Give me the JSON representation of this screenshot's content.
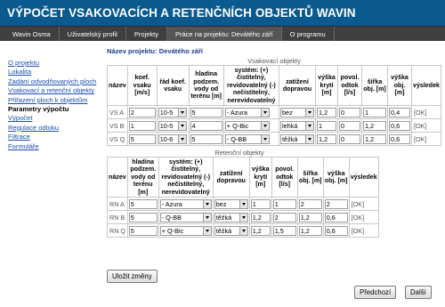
{
  "header": {
    "title": "VÝPOČET VSAKOVACÍCH A RETENČNÍCH OBJEKTŮ WAVIN"
  },
  "topnav": [
    {
      "label": "Wavin Osma"
    },
    {
      "label": "Uživatelský profil"
    },
    {
      "label": "Projekty"
    },
    {
      "label": "Práce na projektu: Devátého září"
    },
    {
      "label": "O programu"
    }
  ],
  "sidebar": [
    {
      "label": "O projektu"
    },
    {
      "label": "Lokalita"
    },
    {
      "label": "Zadání odvodňovaných ploch"
    },
    {
      "label": "Vsakovací a retenční objekty"
    },
    {
      "label": "Přiřazení ploch k objektům"
    },
    {
      "label": "Parametry výpočtu"
    },
    {
      "label": "Výpočet"
    },
    {
      "label": "Regulace odtoku"
    },
    {
      "label": "Filtrace"
    },
    {
      "label": "Formuláře"
    }
  ],
  "main": {
    "project_name": "Název projektu: Devátého září",
    "vsak": {
      "title": "Vsakovací objekty",
      "headers": [
        "název",
        "koef. vsaku [m/s]",
        "řád koef. vsaku",
        "hladina podzem. vody od terénu [m]",
        "systém: (+) čistitelný, revidovatelný (-) nečistitelný, nerevidovatelný",
        "zatížení dopravou",
        "výška krytí [m]",
        "povol. odtok [l/s]",
        "šířka obj. [m]",
        "výška obj. [m]",
        "výsledek"
      ],
      "rows": [
        {
          "name": "VS A",
          "koef": "2",
          "rad": "10-5",
          "hladina": "5",
          "system": "- Azura",
          "zatizeni": "bez",
          "kryti": "1,2",
          "odtok": "0",
          "sirka": "1",
          "vyska": "0,4",
          "vysledek": "[OK]"
        },
        {
          "name": "VS B",
          "koef": "1",
          "rad": "10-5",
          "hladina": "4",
          "system": "+ Q-Bic",
          "zatizeni": "lehká",
          "kryti": "1",
          "odtok": "0",
          "sirka": "1,2",
          "vyska": "0,6",
          "vysledek": "[OK]"
        },
        {
          "name": "VS Q",
          "koef": "5",
          "rad": "10-6",
          "hladina": "5",
          "system": "- Q-BB",
          "zatizeni": "těžká",
          "kryti": "1,2",
          "odtok": "0",
          "sirka": "1,2",
          "vyska": "0,6",
          "vysledek": "[OK]"
        }
      ]
    },
    "ret": {
      "title": "Retenční objekty",
      "headers": [
        "název",
        "hladina podzem. vody od terénu [m]",
        "systém: (+) čistitelný, revidovatelný (-) nečistitelný, nerevidovatelný",
        "zatížení dopravou",
        "výška krytí [m]",
        "povol. odtok [l/s]",
        "šířka obj. [m]",
        "výška obj. [m]",
        "výsledek"
      ],
      "rows": [
        {
          "name": "RN A",
          "hladina": "5",
          "system": "- Azura",
          "zatizeni": "bez",
          "kryti": "1",
          "odtok": "1",
          "sirka": "2",
          "vyska": "2",
          "vysledek": "[OK]"
        },
        {
          "name": "RN B",
          "hladina": "5",
          "system": "- Q-BB",
          "zatizeni": "těžká",
          "kryti": "1,2",
          "odtok": "2",
          "sirka": "1,2",
          "vyska": "0,6",
          "vysledek": "[OK]"
        },
        {
          "name": "RN Q",
          "hladina": "5",
          "system": "+ Q-Bic",
          "zatizeni": "těžká",
          "kryti": "1,2",
          "odtok": "1,5",
          "sirka": "1,2",
          "vyska": "0,6",
          "vysledek": "[OK]"
        }
      ]
    }
  },
  "buttons": {
    "save": "Uložit změny",
    "prev": "Předchozí",
    "next": "Další"
  }
}
